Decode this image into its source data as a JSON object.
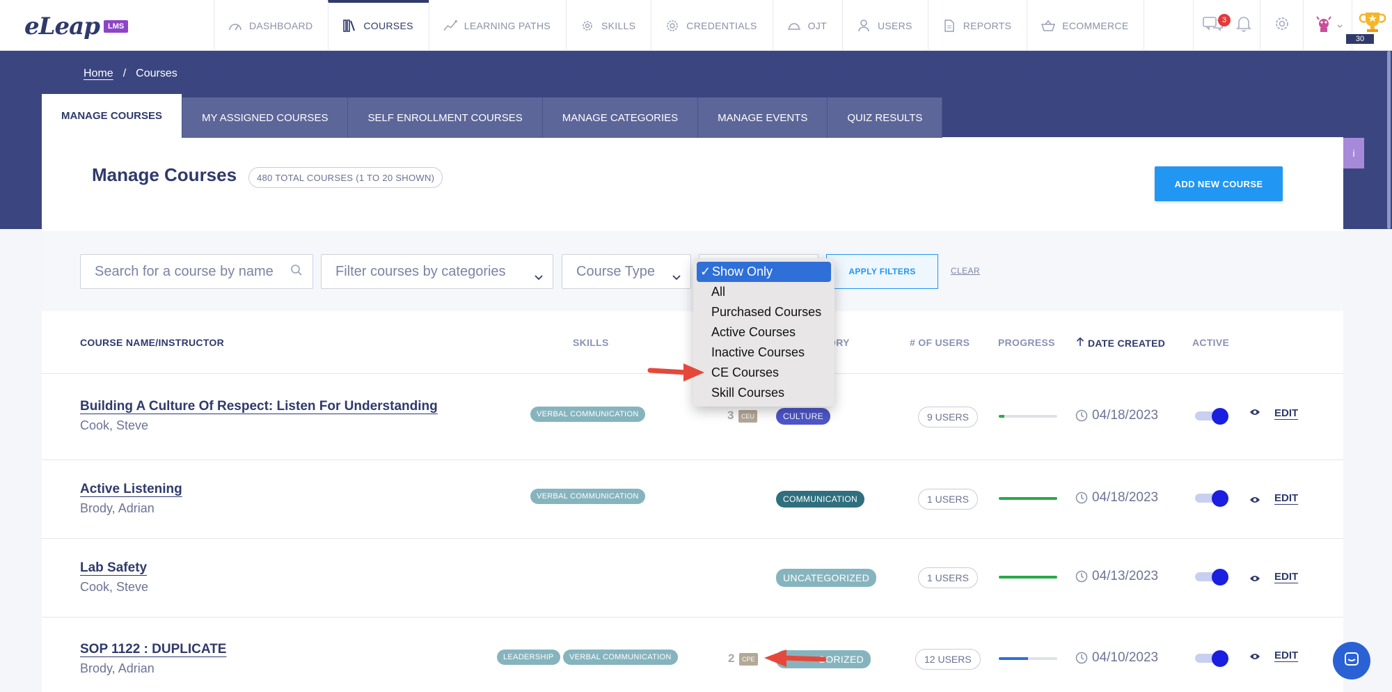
{
  "app": {
    "logo_text": "eLeap",
    "logo_badge": "LMS"
  },
  "nav": {
    "items": [
      {
        "label": "DASHBOARD",
        "icon": "gauge-icon"
      },
      {
        "label": "COURSES",
        "icon": "books-icon",
        "active": true
      },
      {
        "label": "LEARNING PATHS",
        "icon": "path-icon"
      },
      {
        "label": "SKILLS",
        "icon": "gear-skill-icon"
      },
      {
        "label": "CREDENTIALS",
        "icon": "badge-icon"
      },
      {
        "label": "OJT",
        "icon": "hardhat-icon"
      },
      {
        "label": "USERS",
        "icon": "user-icon"
      },
      {
        "label": "REPORTS",
        "icon": "report-icon"
      },
      {
        "label": "ECOMMERCE",
        "icon": "basket-icon"
      }
    ],
    "notification_count": "3",
    "trophy_points": "30"
  },
  "breadcrumb": {
    "home": "Home",
    "separator": "/",
    "current": "Courses"
  },
  "tabs": [
    "MANAGE COURSES",
    "MY ASSIGNED COURSES",
    "SELF ENROLLMENT COURSES",
    "MANAGE CATEGORIES",
    "MANAGE EVENTS",
    "QUIZ RESULTS"
  ],
  "side_tab": "i",
  "page": {
    "title": "Manage Courses",
    "count_label": "480 TOTAL COURSES (1 TO 20 SHOWN)",
    "add_button": "ADD NEW COURSE"
  },
  "filters": {
    "search_placeholder": "Search for a course by name",
    "category_placeholder": "Filter courses by categories",
    "course_type": "Course Type",
    "apply": "APPLY FILTERS",
    "clear": "CLEAR",
    "show_only_menu": {
      "selected": "Show Only",
      "options": [
        "All",
        "Purchased Courses",
        "Active Courses",
        "Inactive Courses",
        "CE Courses",
        "Skill Courses"
      ]
    }
  },
  "table": {
    "headers": {
      "name": "COURSE NAME/INSTRUCTOR",
      "skills": "SKILLS",
      "category": "ORY",
      "users": "# OF USERS",
      "progress": "PROGRESS",
      "date": "DATE CREATED",
      "active": "ACTIVE"
    },
    "edit_label": "EDIT",
    "rows": [
      {
        "name": "Building A Culture Of Respect: Listen For Understanding",
        "instructor": "Cook, Steve",
        "skills": [
          "VERBAL COMMUNICATION"
        ],
        "credit_num": "3",
        "credit_type": "CEU",
        "category": "CULTURE",
        "category_color": "#4d56c9",
        "users": "9 USERS",
        "progress": 0.1,
        "progress_color": "#2ba84a",
        "date": "04/18/2023",
        "active": true
      },
      {
        "name": "Active Listening",
        "instructor": "Brody, Adrian",
        "skills": [
          "VERBAL COMMUNICATION"
        ],
        "credit_num": "",
        "credit_type": "",
        "category": "COMMUNICATION",
        "category_color": "#2f6f7e",
        "users": "1 USERS",
        "progress": 1.0,
        "progress_color": "#2ba84a",
        "date": "04/18/2023",
        "active": true
      },
      {
        "name": "Lab Safety",
        "instructor": "Cook, Steve",
        "skills": [],
        "credit_num": "",
        "credit_type": "",
        "category": "UNCATEGORIZED",
        "category_color": "#86b4be",
        "users": "1 USERS",
        "progress": 1.0,
        "progress_color": "#2ba84a",
        "date": "04/13/2023",
        "active": true
      },
      {
        "name": "SOP 1122 : DUPLICATE",
        "instructor": "Brody, Adrian",
        "skills": [
          "LEADERSHIP",
          "VERBAL COMMUNICATION"
        ],
        "credit_num": "2",
        "credit_type": "CPE",
        "category": "UNCATEGORIZED",
        "category_visible": "GORIZED",
        "category_color": "#86b4be",
        "users": "12 USERS",
        "progress": 0.5,
        "progress_color": "#2f6fd8",
        "date": "04/10/2023",
        "active": true
      }
    ]
  },
  "colors": {
    "banner": "#3b4680",
    "primary": "#2196f3",
    "nav_text": "#2f3a6b",
    "arrow": "#e5483b"
  }
}
